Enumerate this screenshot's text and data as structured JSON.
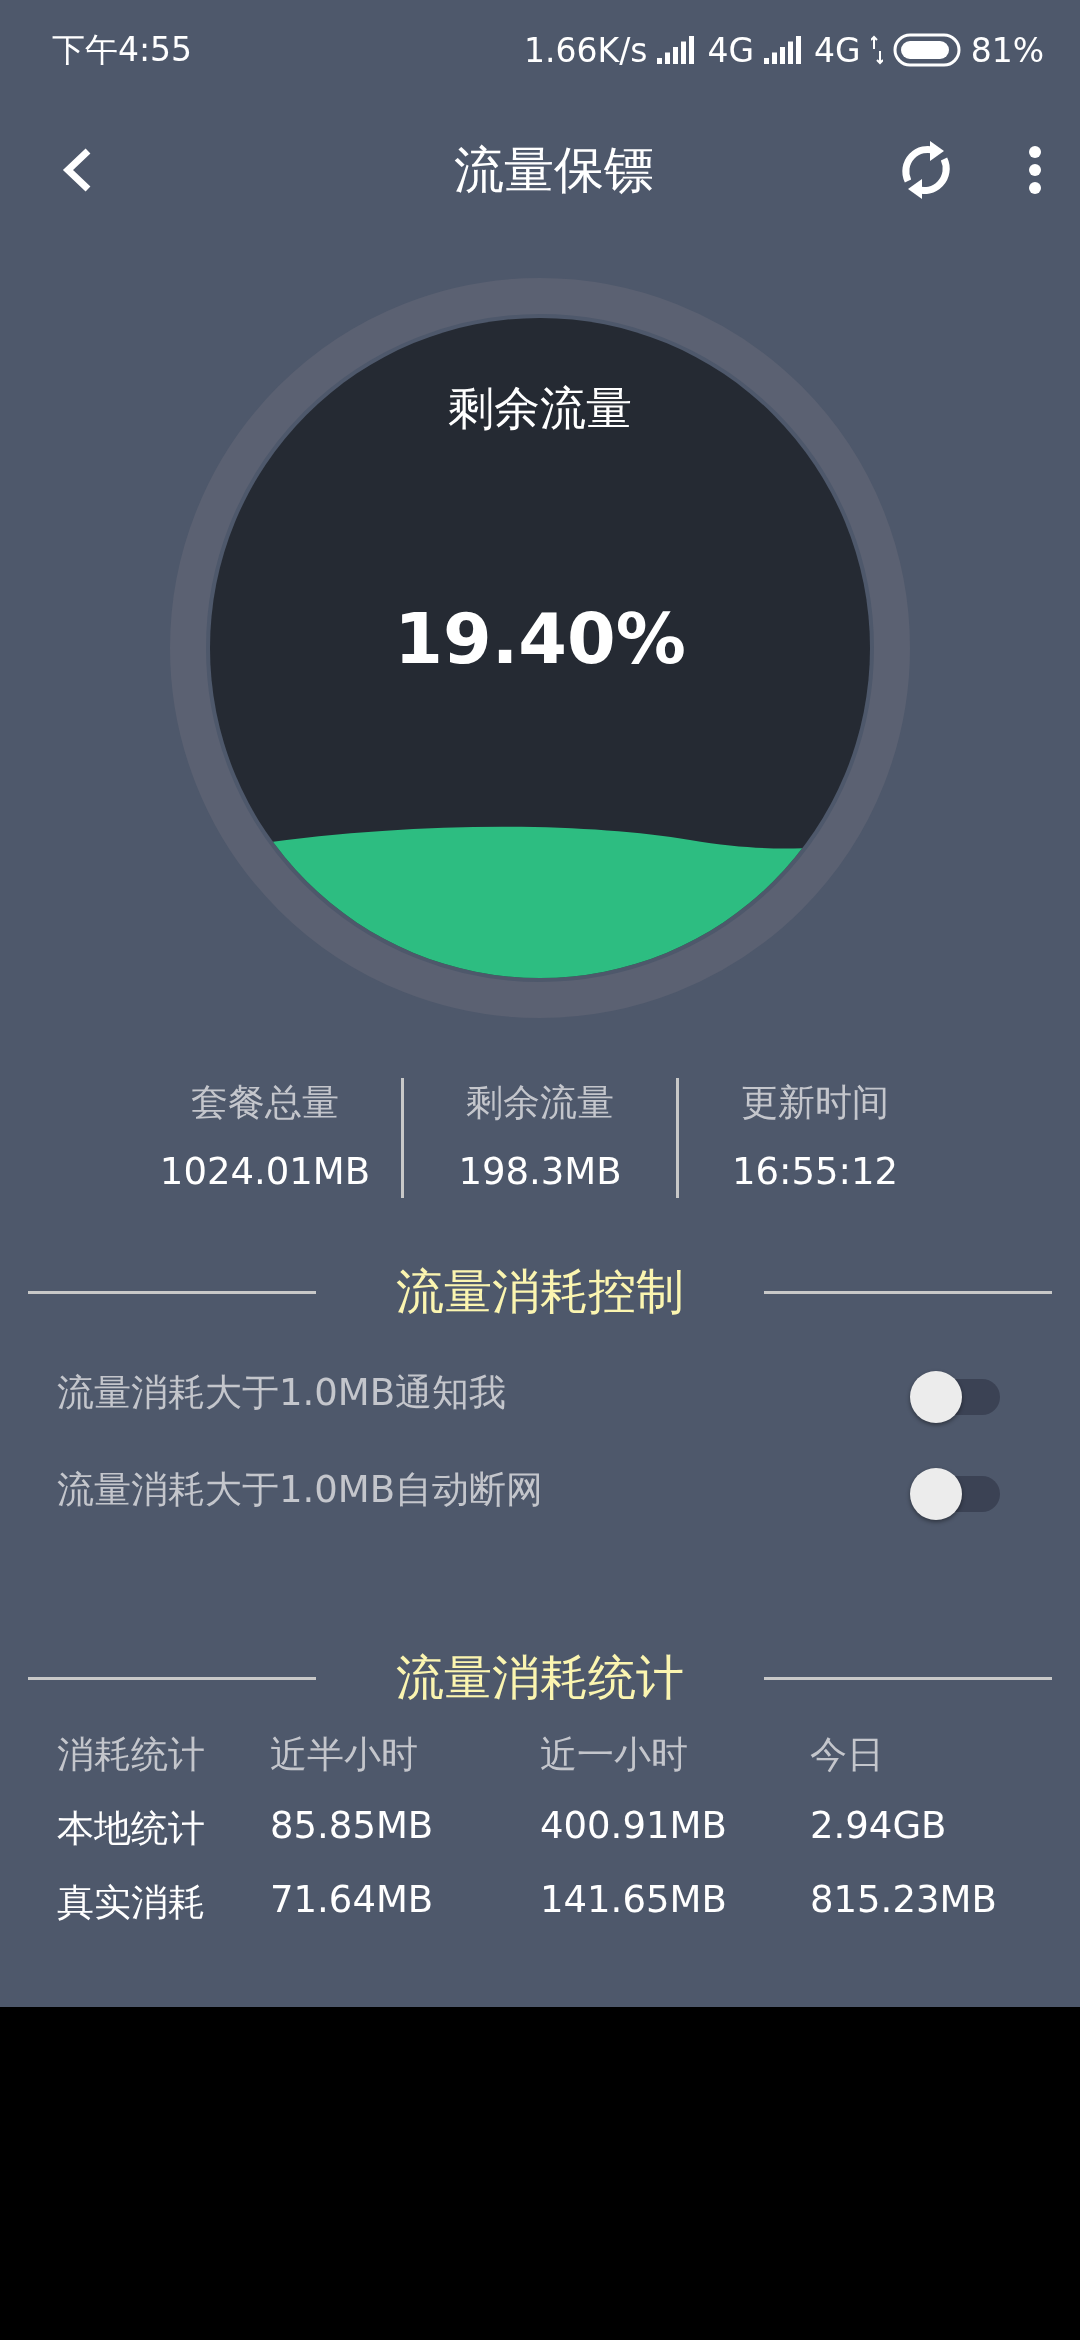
{
  "status_bar": {
    "time": "下午4:55",
    "speed": "1.66K/s",
    "network_1": "4G",
    "network_2": "4G",
    "battery": "81%"
  },
  "toolbar": {
    "title": "流量保镖"
  },
  "gauge": {
    "label": "剩余流量",
    "percent": "19.40%"
  },
  "summary": [
    {
      "label": "套餐总量",
      "value": "1024.01MB"
    },
    {
      "label": "剩余流量",
      "value": "198.3MB"
    },
    {
      "label": "更新时间",
      "value": "16:55:12"
    }
  ],
  "control_section": {
    "title": "流量消耗控制",
    "toggles": [
      {
        "label": "流量消耗大于1.0MB通知我",
        "on": false
      },
      {
        "label": "流量消耗大于1.0MB自动断网",
        "on": false
      }
    ]
  },
  "stats_section": {
    "title": "流量消耗统计",
    "columns": [
      "消耗统计",
      "近半小时",
      "近一小时",
      "今日"
    ],
    "rows": [
      [
        "本地统计",
        "85.85MB",
        "400.91MB",
        "2.94GB"
      ],
      [
        "真实消耗",
        "71.64MB",
        "141.65MB",
        "815.23MB"
      ]
    ]
  }
}
